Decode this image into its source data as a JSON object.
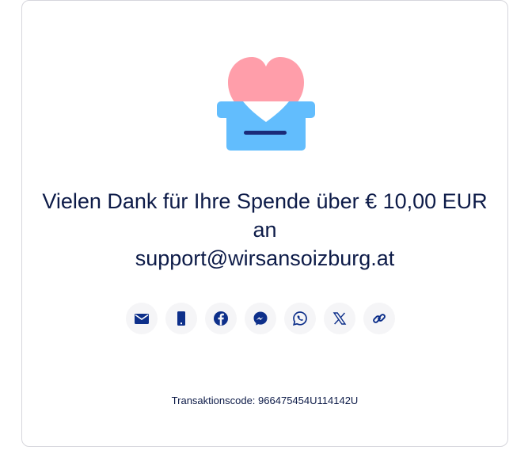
{
  "confirmation": {
    "title_line1": "Vielen Dank für Ihre Spende über € 10,00 EUR",
    "title_line2": "an",
    "title_line3": "support@wirsansoizburg.at"
  },
  "share": {
    "items": [
      {
        "icon": "mail-icon",
        "label": "E-Mail"
      },
      {
        "icon": "mobile-icon",
        "label": "SMS"
      },
      {
        "icon": "facebook-icon",
        "label": "Facebook"
      },
      {
        "icon": "messenger-icon",
        "label": "Messenger"
      },
      {
        "icon": "whatsapp-icon",
        "label": "WhatsApp"
      },
      {
        "icon": "x-icon",
        "label": "X"
      },
      {
        "icon": "link-icon",
        "label": "Link kopieren"
      }
    ]
  },
  "transaction": {
    "label": "Transaktionscode:",
    "code": "966475454U114142U"
  },
  "colors": {
    "heart": "#ff9eaa",
    "box": "#62bdfd",
    "slot": "#1a2a78",
    "text": "#0d1b48",
    "icon": "#0d2f8a",
    "button_bg": "#f5f5f7",
    "border": "#d6d6dc"
  }
}
